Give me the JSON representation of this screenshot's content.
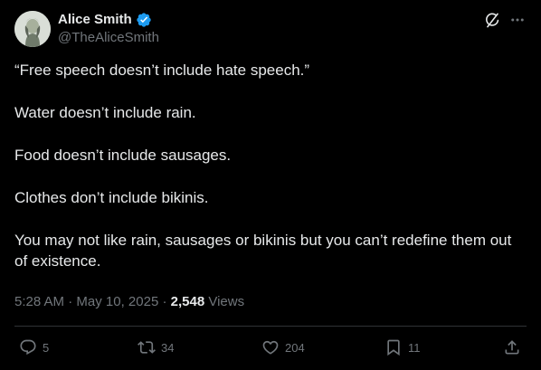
{
  "author": {
    "name": "Alice Smith",
    "handle": "@TheAliceSmith",
    "verified": true,
    "verified_color": "#1d9bf0"
  },
  "top_actions": {
    "grok_icon": "grok-icon",
    "more_icon": "more-icon"
  },
  "tweet": {
    "paragraphs": [
      "“Free speech doesn’t include hate speech.”",
      "Water doesn’t include rain.",
      "Food doesn’t include sausages.",
      "Clothes don’t include bikinis.",
      "You may not like rain, sausages or bikinis but you can’t redefine them out of existence."
    ]
  },
  "meta": {
    "time": "5:28 AM",
    "separator": "·",
    "date": "May 10, 2025",
    "views_count": "2,548",
    "views_label": "Views"
  },
  "engagement": {
    "replies": "5",
    "reposts": "34",
    "likes": "204",
    "bookmarks": "11"
  },
  "colors": {
    "background": "#000000",
    "text": "#e7e9ea",
    "secondary": "#71767b",
    "divider": "#2f3336"
  }
}
